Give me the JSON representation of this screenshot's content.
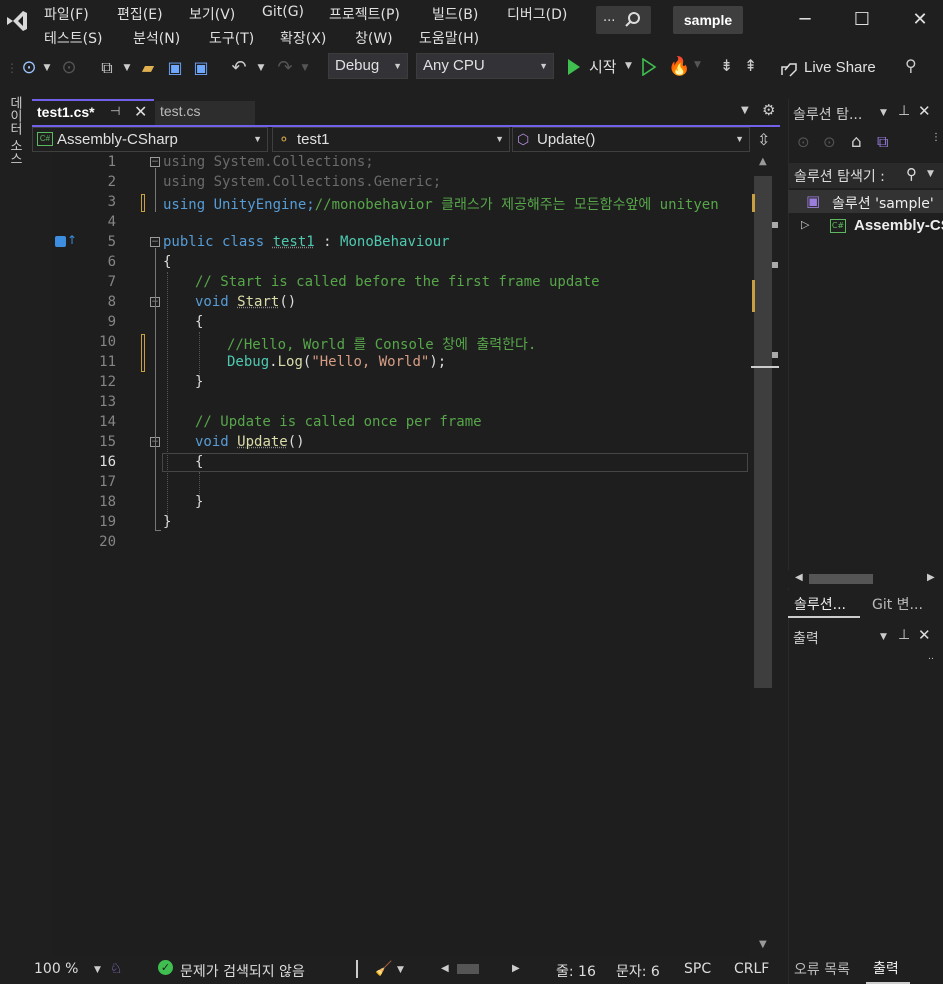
{
  "menu": {
    "row1": [
      "파일(F)",
      "편집(E)",
      "보기(V)",
      "Git(G)",
      "프로젝트(P)",
      "빌드(B)",
      "디버그(D)"
    ],
    "row2": [
      "테스트(S)",
      "분석(N)",
      "도구(T)",
      "확장(X)",
      "창(W)",
      "도움말(H)"
    ],
    "search_label": "...",
    "project_name": "sample"
  },
  "toolbar": {
    "config": "Debug",
    "platform": "Any CPU",
    "start_label": "시작",
    "live_share": "Live Share"
  },
  "left_strip": {
    "label": "데이터 소스"
  },
  "tabs": [
    {
      "label": "test1.cs*",
      "active": true
    },
    {
      "label": "test.cs",
      "active": false
    }
  ],
  "navbar": {
    "project": "Assembly-CSharp",
    "class": "test1",
    "member": "Update()"
  },
  "code": {
    "line_numbers": [
      "1",
      "2",
      "3",
      "4",
      "5",
      "6",
      "7",
      "8",
      "9",
      "10",
      "11",
      "12",
      "13",
      "14",
      "15",
      "16",
      "17",
      "18",
      "19",
      "20"
    ],
    "l1": "using System.Collections;",
    "l2": "using System.Collections.Generic;",
    "l3a": "using UnityEngine;",
    "l3b": "//monobehavior 클래스가 제공해주는 모든함수앞에 unityen",
    "l5a": "public class ",
    "l5b": "test1",
    "l5c": " : ",
    "l5d": "MonoBehaviour",
    "l6": "{",
    "l7": "// Start is called before the first frame update",
    "l8a": "void ",
    "l8b": "Start",
    "l8c": "()",
    "l9": "{",
    "l10": "//Hello, World 를 Console 창에 출력한다.",
    "l11a": "Debug",
    "l11b": ".",
    "l11c": "Log",
    "l11d": "(",
    "l11e": "\"Hello, World\"",
    "l11f": ");",
    "l12": "}",
    "l14": "// Update is called once per frame",
    "l15a": "void ",
    "l15b": "Update",
    "l15c": "()",
    "l16": "{",
    "l18": "}",
    "l19": "}"
  },
  "solution_explorer": {
    "title": "솔루션 탐...",
    "search_label": "솔루션 탐색기 :",
    "solution_item": "솔루션 'sample'",
    "project_item": "Assembly-CS",
    "tab1": "솔루션...",
    "tab2": "Git 변..."
  },
  "output_pane": {
    "title": "출력",
    "tab1": "오류 목록",
    "tab2": "출력"
  },
  "statusbar": {
    "zoom": "100 %",
    "issues": "문제가 검색되지 않음",
    "line": "줄: 16",
    "col": "문자: 6",
    "spc": "SPC",
    "crlf": "CRLF"
  },
  "colors": {
    "accent": "#7160e8",
    "keyword": "#569cd6",
    "comment": "#57a64a",
    "type": "#4ec9b0",
    "string": "#d69d85"
  }
}
